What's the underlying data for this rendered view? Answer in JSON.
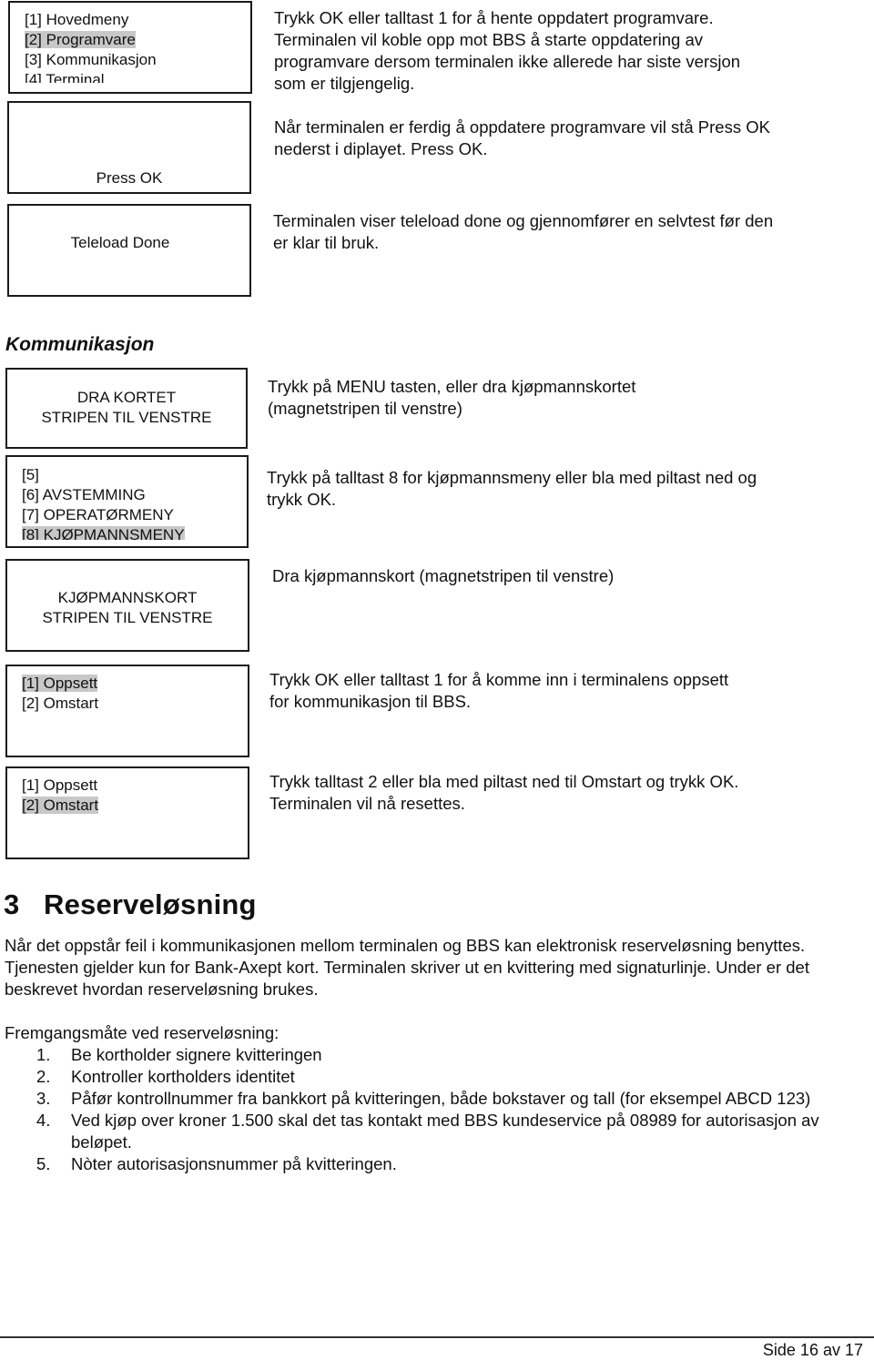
{
  "programvare_section": {
    "screens": [
      {
        "type": "menu",
        "items": [
          {
            "label": "[1] Hovedmeny",
            "highlighted": false
          },
          {
            "label": "[2] Programvare",
            "highlighted": true
          },
          {
            "label": "[3] Kommunikasjon",
            "highlighted": false
          },
          {
            "label": "[4] Terminal",
            "highlighted": false
          }
        ],
        "description": "Trykk OK eller talltast 1 for å hente oppdatert programvare. Terminalen vil koble opp mot BBS å starte oppdatering av programvare dersom terminalen ikke allerede har siste versjon som er tilgjengelig."
      },
      {
        "type": "message",
        "lines": [
          "Press OK"
        ],
        "description": "Når terminalen er ferdig å oppdatere programvare vil stå Press OK nederst i diplayet. Press OK."
      },
      {
        "type": "message",
        "lines": [
          "Teleload Done"
        ],
        "description": "Terminalen viser teleload done og gjennomfører en selvtest før den er klar til bruk."
      }
    ]
  },
  "kommunikasjon_section": {
    "heading": "Kommunikasjon",
    "screens": [
      {
        "type": "message",
        "lines": [
          "DRA KORTET",
          "STRIPEN TIL VENSTRE"
        ],
        "description": "Trykk på MENU tasten, eller dra kjøpmannskortet (magnetstripen til venstre)"
      },
      {
        "type": "menu",
        "items": [
          {
            "label": "[5]",
            "highlighted": false
          },
          {
            "label": "[6] AVSTEMMING",
            "highlighted": false
          },
          {
            "label": "[7] OPERATØRMENY",
            "highlighted": false
          },
          {
            "label": "[8] KJØPMANNSMENY",
            "highlighted": true
          }
        ],
        "description": "Trykk på talltast 8 for kjøpmannsmeny eller bla med piltast ned og trykk OK."
      },
      {
        "type": "message",
        "lines": [
          "KJØPMANNSKORT",
          "STRIPEN TIL VENSTRE"
        ],
        "description": "Dra kjøpmannskort (magnetstripen til venstre)"
      },
      {
        "type": "menu",
        "items": [
          {
            "label": "[1] Oppsett",
            "highlighted": true
          },
          {
            "label": "[2] Omstart",
            "highlighted": false
          }
        ],
        "description": "Trykk OK eller talltast 1 for å komme inn i terminalens oppsett for kommunikasjon til BBS."
      },
      {
        "type": "menu",
        "items": [
          {
            "label": "[1] Oppsett",
            "highlighted": false
          },
          {
            "label": "[2] Omstart",
            "highlighted": true
          }
        ],
        "description": "Trykk talltast 2 eller bla med piltast ned til Omstart og trykk OK. Terminalen vil nå resettes."
      }
    ]
  },
  "reserve_section": {
    "number": "3",
    "title": "Reserveløsning",
    "intro": "Når det oppstår feil i kommunikasjonen mellom terminalen og BBS kan elektronisk reserveløsning benyttes. Tjenesten gjelder kun for Bank-Axept kort. Terminalen skriver ut en kvittering med signaturlinje. Under er det beskrevet hvordan reserveløsning brukes.",
    "procedure_label": "Fremgangsmåte ved reserveløsning:",
    "steps": [
      {
        "n": "1.",
        "text": "Be kortholder signere kvitteringen"
      },
      {
        "n": "2.",
        "text": "Kontroller kortholders identitet"
      },
      {
        "n": "3.",
        "text": "Påfør kontrollnummer fra bankkort på kvitteringen, både bokstaver og tall (for eksempel ABCD 123)"
      },
      {
        "n": "4.",
        "text": "Ved kjøp over kroner 1.500 skal det tas kontakt med BBS kundeservice på 08989 for autorisasjon av beløpet."
      },
      {
        "n": "5.",
        "text": "Nòter autorisasjonsnummer på kvitteringen."
      }
    ]
  },
  "footer": {
    "page_label": "Side 16 av 17"
  },
  "colors": {
    "highlight": "#c8c8c8",
    "border": "#1a1a1a",
    "text": "#111111"
  }
}
